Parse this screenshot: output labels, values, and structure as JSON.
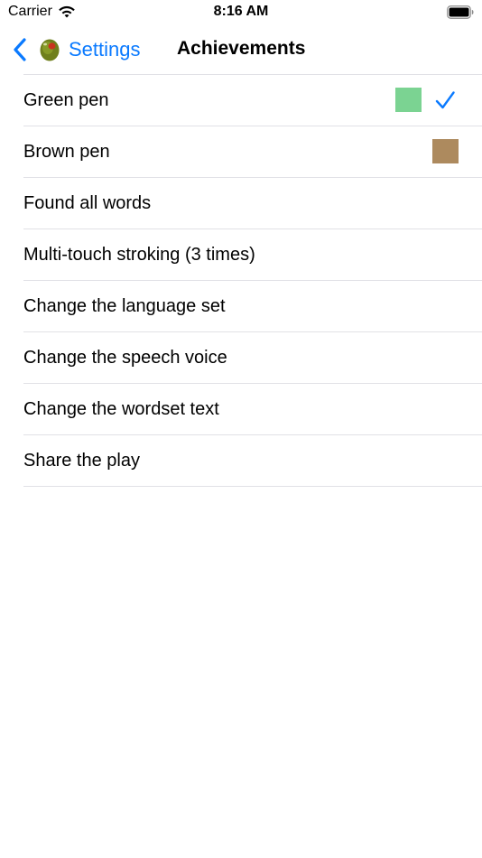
{
  "status": {
    "carrier": "Carrier",
    "time": "8:16 AM"
  },
  "nav": {
    "back_label": "Settings",
    "title": "Achievements"
  },
  "items": [
    {
      "label": "Green pen",
      "swatch_color": "#7bd392",
      "checked": true
    },
    {
      "label": "Brown pen",
      "swatch_color": "#ad8a5e",
      "checked": false
    },
    {
      "label": "Found all words"
    },
    {
      "label": "Multi-touch stroking (3 times)"
    },
    {
      "label": "Change the language set"
    },
    {
      "label": "Change the speech voice"
    },
    {
      "label": "Change the wordset text"
    },
    {
      "label": "Share the play"
    }
  ],
  "colors": {
    "accent": "#0a7aff",
    "separator": "#e1e1e6"
  },
  "icons": {
    "wifi": "wifi-icon",
    "battery": "battery-icon",
    "back": "chevron-left-icon",
    "olive": "olive-icon",
    "check": "checkmark-icon"
  }
}
